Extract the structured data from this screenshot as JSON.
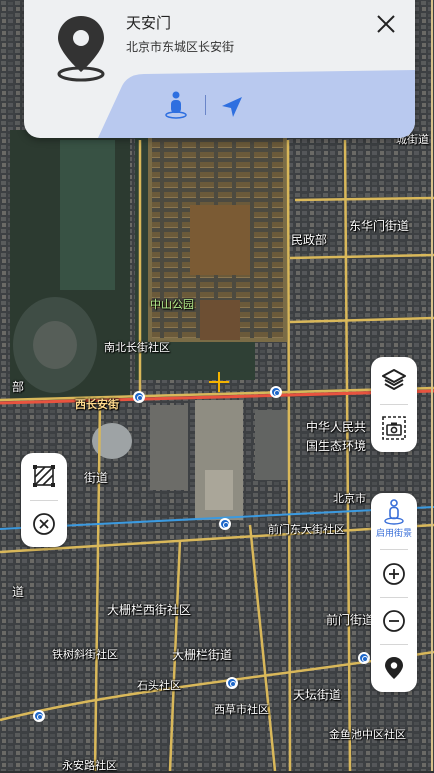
{
  "card": {
    "name": "天安门",
    "address": "北京市东城区长安街"
  },
  "controls": {
    "street_view_label": "启用街景"
  },
  "map_labels": {
    "zhongshan_park": "中山公园",
    "nanbeichang": "南北长街社区",
    "xichangan": "西长安街",
    "minzhengbu": "民政部",
    "donghuamen": "东华门街道",
    "eco_ministry_1": "中华人民共",
    "eco_ministry_2": "国生态环境",
    "beijingshi": "北京市",
    "qianmen_east": "前门东大街社区",
    "street_left": "街道",
    "dashilan_west": "大栅栏西街社区",
    "tiexie": "铁树斜街社区",
    "dashilan": "大栅栏街道",
    "qianmen_street": "前门街道",
    "shitou": "石头社区",
    "tiantan": "天坛街道",
    "xicaoshi": "西草市社区",
    "jinyuchi": "金鱼池中区社区",
    "yongan": "永安路社区",
    "bu": "部",
    "dao": "道",
    "cheng_street": "城街道"
  },
  "colors": {
    "accent": "#2e6fe0",
    "card_bg": "#eef0f2",
    "card_band": "#b9c9ef"
  }
}
